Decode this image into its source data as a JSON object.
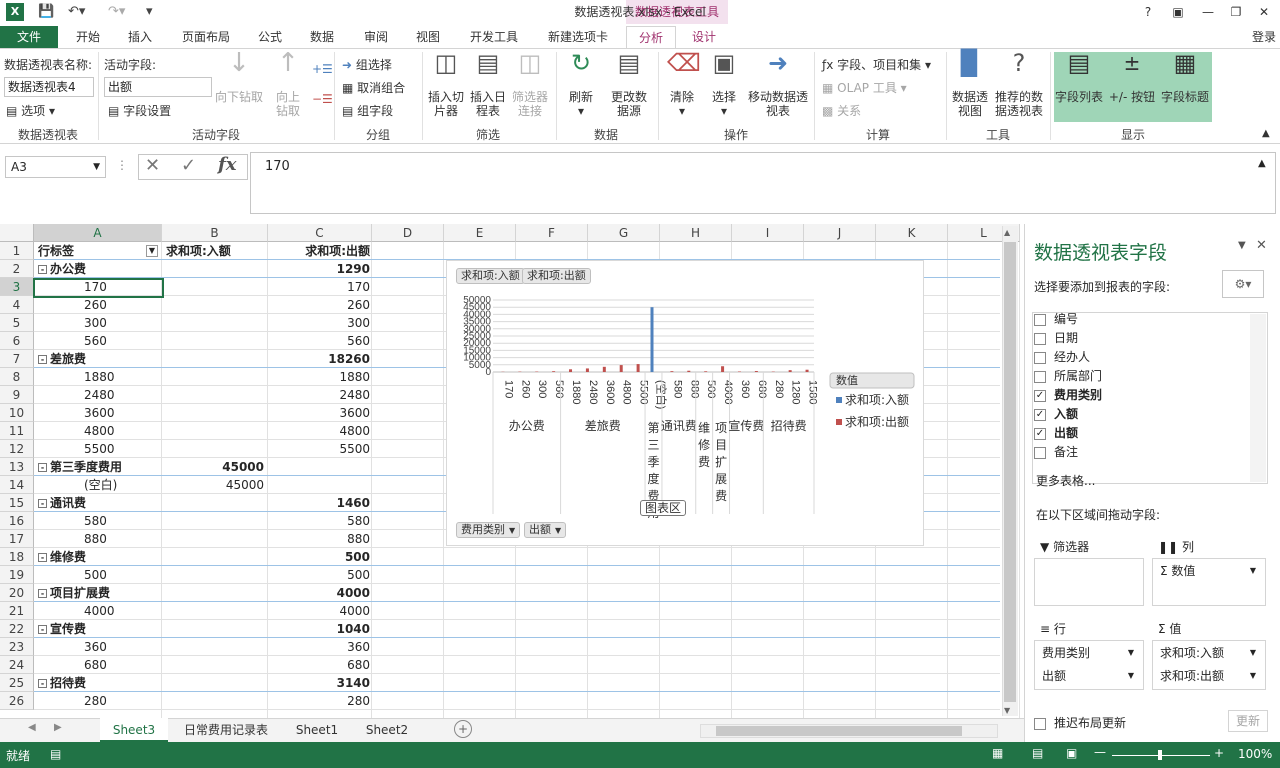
{
  "title_bar": {
    "doc_title": "数据透视表.xlsx - Excel",
    "context_tab": "数据透视表工具",
    "help": "?",
    "login": "登录"
  },
  "tabs": [
    "文件",
    "开始",
    "插入",
    "页面布局",
    "公式",
    "数据",
    "审阅",
    "视图",
    "开发工具",
    "新建选项卡",
    "分析",
    "设计"
  ],
  "ribbon": {
    "pivot": {
      "name_label": "数据透视表名称:",
      "name_value": "数据透视表4",
      "options": "选项",
      "group": "数据透视表"
    },
    "active_field": {
      "label": "活动字段:",
      "value": "出额",
      "settings": "字段设置",
      "drill_down": "向下钻取",
      "drill_up": "向上钻取",
      "group": "活动字段"
    },
    "group_grp": {
      "selection": "组选择",
      "ungroup": "取消组合",
      "field": "组字段",
      "group": "分组"
    },
    "filter": {
      "slicer": "插入切片器",
      "timeline": "插入日程表",
      "connections": "筛选器连接",
      "group": "筛选"
    },
    "data": {
      "refresh": "刷新",
      "change_source": "更改数据源",
      "group": "数据"
    },
    "actions": {
      "clear": "清除",
      "select": "选择",
      "move": "移动数据透视表",
      "group": "操作"
    },
    "calc": {
      "fields_items": "字段、项目和集",
      "olap": "OLAP 工具",
      "relations": "关系",
      "group": "计算"
    },
    "tools": {
      "pivot_chart": "数据透视图",
      "recommended": "推荐的数据透视表",
      "group": "工具"
    },
    "show": {
      "field_list": "字段列表",
      "buttons": "+/- 按钮",
      "headers": "字段标题",
      "group": "显示"
    }
  },
  "formula": {
    "cell_ref": "A3",
    "value": "170"
  },
  "columns": [
    "A",
    "B",
    "C",
    "D",
    "E",
    "F",
    "G",
    "H",
    "I",
    "J",
    "K",
    "L"
  ],
  "rows": [
    {
      "n": "1",
      "a": "行标签",
      "b": "求和项:入额",
      "c": "求和项:出额",
      "type": "header"
    },
    {
      "n": "2",
      "a": "办公费",
      "b": "",
      "c": "1290",
      "type": "group"
    },
    {
      "n": "3",
      "a": "170",
      "b": "",
      "c": "170",
      "type": "item"
    },
    {
      "n": "4",
      "a": "260",
      "b": "",
      "c": "260",
      "type": "item"
    },
    {
      "n": "5",
      "a": "300",
      "b": "",
      "c": "300",
      "type": "item"
    },
    {
      "n": "6",
      "a": "560",
      "b": "",
      "c": "560",
      "type": "item"
    },
    {
      "n": "7",
      "a": "差旅费",
      "b": "",
      "c": "18260",
      "type": "group"
    },
    {
      "n": "8",
      "a": "1880",
      "b": "",
      "c": "1880",
      "type": "item"
    },
    {
      "n": "9",
      "a": "2480",
      "b": "",
      "c": "2480",
      "type": "item"
    },
    {
      "n": "10",
      "a": "3600",
      "b": "",
      "c": "3600",
      "type": "item"
    },
    {
      "n": "11",
      "a": "4800",
      "b": "",
      "c": "4800",
      "type": "item"
    },
    {
      "n": "12",
      "a": "5500",
      "b": "",
      "c": "5500",
      "type": "item"
    },
    {
      "n": "13",
      "a": "第三季度费用",
      "b": "45000",
      "c": "",
      "type": "group"
    },
    {
      "n": "14",
      "a": "(空白)",
      "b": "45000",
      "c": "",
      "type": "item"
    },
    {
      "n": "15",
      "a": "通讯费",
      "b": "",
      "c": "1460",
      "type": "group"
    },
    {
      "n": "16",
      "a": "580",
      "b": "",
      "c": "580",
      "type": "item"
    },
    {
      "n": "17",
      "a": "880",
      "b": "",
      "c": "880",
      "type": "item"
    },
    {
      "n": "18",
      "a": "维修费",
      "b": "",
      "c": "500",
      "type": "group"
    },
    {
      "n": "19",
      "a": "500",
      "b": "",
      "c": "500",
      "type": "item"
    },
    {
      "n": "20",
      "a": "项目扩展费",
      "b": "",
      "c": "4000",
      "type": "group"
    },
    {
      "n": "21",
      "a": "4000",
      "b": "",
      "c": "4000",
      "type": "item"
    },
    {
      "n": "22",
      "a": "宣传费",
      "b": "",
      "c": "1040",
      "type": "group"
    },
    {
      "n": "23",
      "a": "360",
      "b": "",
      "c": "360",
      "type": "item"
    },
    {
      "n": "24",
      "a": "680",
      "b": "",
      "c": "680",
      "type": "item"
    },
    {
      "n": "25",
      "a": "招待费",
      "b": "",
      "c": "3140",
      "type": "group"
    },
    {
      "n": "26",
      "a": "280",
      "b": "",
      "c": "280",
      "type": "item"
    }
  ],
  "chart_data": {
    "type": "bar",
    "chips": [
      "求和项:入额",
      "求和项:出额"
    ],
    "axis_chips": [
      "费用类别",
      "出额"
    ],
    "yticks": [
      "50000",
      "45000",
      "40000",
      "35000",
      "30000",
      "25000",
      "20000",
      "15000",
      "10000",
      "5000",
      "0"
    ],
    "ylim": [
      0,
      50000
    ],
    "categories": [
      "170",
      "260",
      "300",
      "560",
      "1880",
      "2480",
      "3600",
      "4800",
      "5500",
      "(空白)",
      "580",
      "880",
      "500",
      "4000",
      "360",
      "680",
      "280",
      "1280",
      "1580"
    ],
    "groups": [
      {
        "label": "办公费",
        "count": 4
      },
      {
        "label": "差旅费",
        "count": 5
      },
      {
        "label": "第三季度费用",
        "count": 1
      },
      {
        "label": "通讯费",
        "count": 2
      },
      {
        "label": "维修费",
        "count": 1
      },
      {
        "label": "项目扩展费",
        "count": 1
      },
      {
        "label": "宣传费",
        "count": 2
      },
      {
        "label": "招待费",
        "count": 3
      }
    ],
    "series": [
      {
        "name": "求和项:入额",
        "color": "#4f81bd",
        "values": [
          0,
          0,
          0,
          0,
          0,
          0,
          0,
          0,
          0,
          45000,
          0,
          0,
          0,
          0,
          0,
          0,
          0,
          0,
          0
        ]
      },
      {
        "name": "求和项:出额",
        "color": "#c0504d",
        "values": [
          170,
          260,
          300,
          560,
          1880,
          2480,
          3600,
          4800,
          5500,
          0,
          580,
          880,
          500,
          4000,
          360,
          680,
          280,
          1280,
          1580
        ]
      }
    ],
    "legend_title": "数值",
    "tooltip": "图表区"
  },
  "panel": {
    "title": "数据透视表字段",
    "subtitle": "选择要添加到报表的字段:",
    "fields": [
      {
        "name": "编号",
        "checked": false
      },
      {
        "name": "日期",
        "checked": false
      },
      {
        "name": "经办人",
        "checked": false
      },
      {
        "name": "所属部门",
        "checked": false
      },
      {
        "name": "费用类别",
        "checked": true
      },
      {
        "name": "入额",
        "checked": true
      },
      {
        "name": "出额",
        "checked": true
      },
      {
        "name": "备注",
        "checked": false
      }
    ],
    "more_tables": "更多表格...",
    "drag_hint": "在以下区域间拖动字段:",
    "filter_label": "筛选器",
    "cols_label": "列",
    "rows_label": "行",
    "values_label": "值",
    "col_items": [
      "Σ 数值"
    ],
    "row_items": [
      "费用类别",
      "出额"
    ],
    "value_items": [
      "求和项:入额",
      "求和项:出额"
    ],
    "defer": "推迟布局更新",
    "update": "更新"
  },
  "sheets": [
    "Sheet3",
    "日常费用记录表",
    "Sheet1",
    "Sheet2"
  ],
  "status": {
    "ready": "就绪",
    "zoom": "100%"
  }
}
